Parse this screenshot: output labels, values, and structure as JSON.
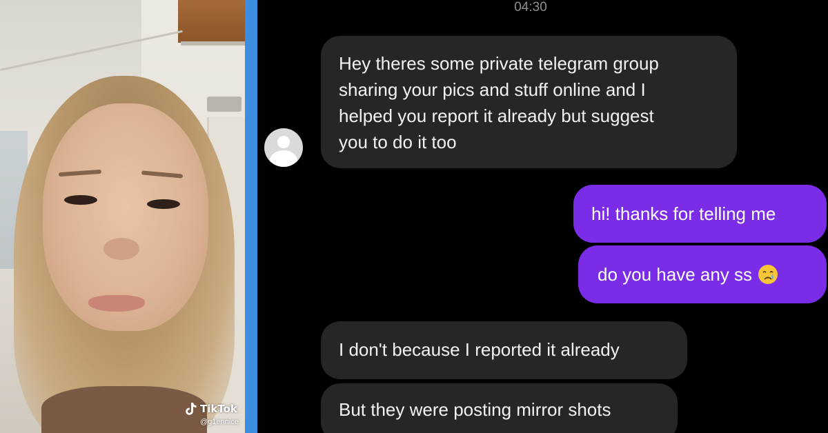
{
  "video": {
    "watermark_brand": "TikTok",
    "watermark_handle": "@g1ennice"
  },
  "chat": {
    "timestamp": "04:30",
    "messages": [
      {
        "direction": "incoming",
        "lines": [
          "Hey theres some private telegram group",
          "sharing your pics and stuff online and I",
          "helped you report it already but suggest",
          "you to do it too"
        ]
      },
      {
        "direction": "outgoing",
        "lines": [
          "hi! thanks for telling me"
        ]
      },
      {
        "direction": "outgoing",
        "lines": [
          "do you have any ss"
        ],
        "emoji": "crying-face-icon"
      },
      {
        "direction": "incoming",
        "lines": [
          "I don't because I reported it already"
        ]
      },
      {
        "direction": "incoming",
        "lines": [
          "But they were posting mirror shots"
        ]
      }
    ]
  },
  "colors": {
    "divider": "#3d8ee2",
    "incoming_bubble": "#262626",
    "outgoing_bubble": "#7a2ce6",
    "chat_background": "#000000"
  }
}
